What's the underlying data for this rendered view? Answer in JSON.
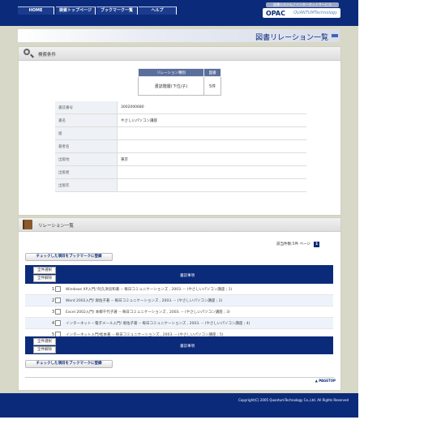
{
  "nav": {
    "tabs": [
      {
        "label": "HOME"
      },
      {
        "label": "検索トップページ"
      },
      {
        "label": "ブックマーク一覧"
      },
      {
        "label": "ヘルプ"
      }
    ]
  },
  "brand": {
    "subtitle": "図書システム / インターネットサービス",
    "opac": "OPAC",
    "vendor": "QUANTUMTechnology"
  },
  "page": {
    "title": "図書リレーション一覧"
  },
  "search_panel": {
    "title": "検索条件",
    "relation_table": {
      "headers": [
        "リレーション種別",
        "図書"
      ],
      "row": [
        "書誌階層(下位/子)",
        "5件"
      ]
    },
    "bib": [
      {
        "key": "書誌番号",
        "value": "3002000680"
      },
      {
        "key": "書名",
        "value": "やさしいパソコン講座"
      },
      {
        "key": "版",
        "value": ""
      },
      {
        "key": "著者名",
        "value": ""
      },
      {
        "key": "出版地",
        "value": "東京"
      },
      {
        "key": "出版者",
        "value": ""
      },
      {
        "key": "出版年",
        "value": ""
      }
    ]
  },
  "relation_panel": {
    "title": "リレーション一覧",
    "hits_label": "該当件数:5件",
    "page_label": "ページ",
    "page_number": "1",
    "bookmark_button": "チェックした項目をブックマークに登録",
    "select_all": "全件選択",
    "deselect_all": "全件解除",
    "column_header": "書誌事項",
    "rows": [
      {
        "num": "1",
        "text": "Windows XP入門/ 阿久津良和著 -- 毎日コミュニケーションズ , 2003. -- (やさしいパソコン講座 ; 1)"
      },
      {
        "num": "2",
        "text": "Word 2002入門/ 堀佑子著 -- 毎日コミュニケーションズ , 2003. -- (やさしいパソコン講座 ; 2)"
      },
      {
        "num": "3",
        "text": "Excel 2002入門/ 本郷千代子著 -- 毎日コミュニケーションズ , 2003. -- (やさしいパソコン講座 ; 3)"
      },
      {
        "num": "4",
        "text": "インターネット・電子メール入門/ 堀佑子著 -- 毎日コミュニケーションズ , 2003. -- (やさしいパソコン講座 ; 4)"
      },
      {
        "num": "5",
        "text": "インターネット入門/松本著 -- 毎日コミュニケーションズ , 2003. -- (やさしいパソコン講座 ; 5)"
      }
    ],
    "pagetop": "PAGETOP"
  },
  "footer": {
    "copyright": "Copyright(C) 2005 QuantumTechnology Co.,Ltd. All Rights Reserved"
  }
}
